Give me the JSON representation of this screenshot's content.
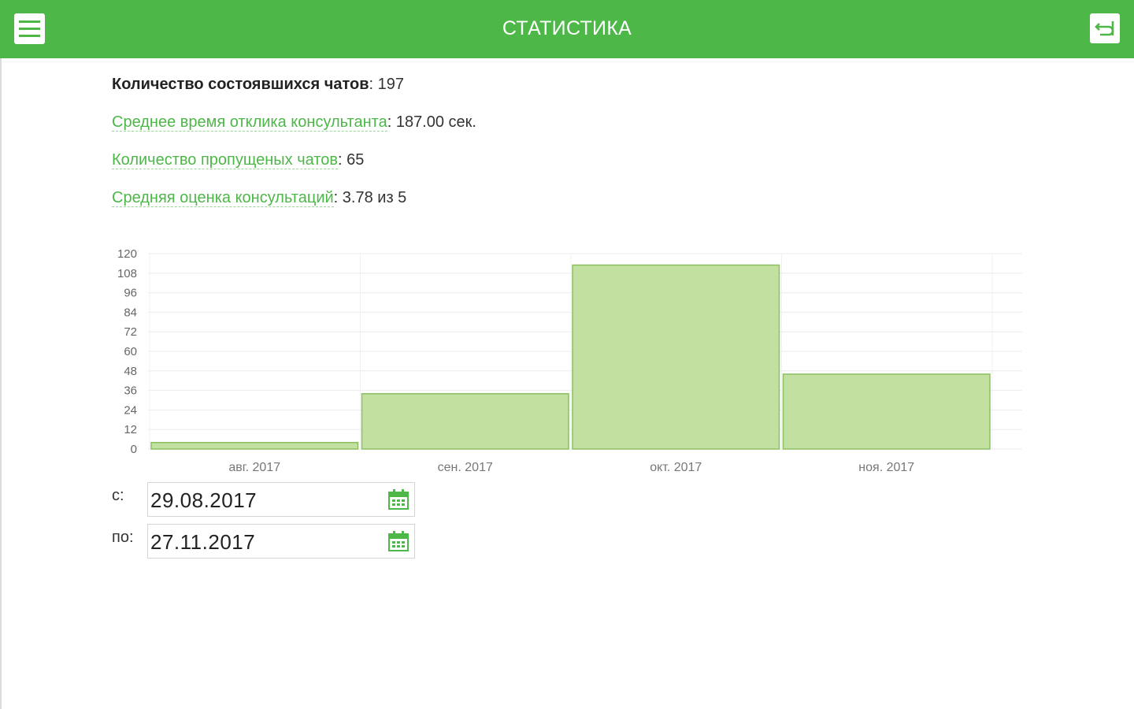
{
  "header": {
    "title": "СТАТИСТИКА",
    "menu_icon": "hamburger-menu-icon",
    "back_icon": "back-arrow-icon",
    "color": "#4db748"
  },
  "stats": [
    {
      "label": "Количество состоявшихся чатов",
      "value": ": 197",
      "style": "bold"
    },
    {
      "label": "Среднее время отклика консультанта",
      "value": ": 187.00 сек.",
      "style": "link"
    },
    {
      "label": "Количество пропущеных чатов",
      "value": ": 65",
      "style": "link"
    },
    {
      "label": "Средняя оценка консультаций",
      "value": ": 3.78 из 5",
      "style": "link"
    }
  ],
  "chart_data": {
    "type": "bar",
    "categories": [
      "авг. 2017",
      "сен. 2017",
      "окт. 2017",
      "ноя. 2017"
    ],
    "values": [
      4,
      34,
      113,
      46
    ],
    "ylim": [
      0,
      120
    ],
    "yticks": [
      0,
      12,
      24,
      36,
      48,
      60,
      72,
      84,
      96,
      108,
      120
    ],
    "grid": true,
    "bar_fill": "#c2e0a0",
    "bar_stroke": "#8cc063"
  },
  "date_range": {
    "from_label": "с:",
    "from_value": "29.08.2017",
    "to_label": "по:",
    "to_value": "27.11.2017",
    "calendar_icon": "calendar-icon"
  }
}
